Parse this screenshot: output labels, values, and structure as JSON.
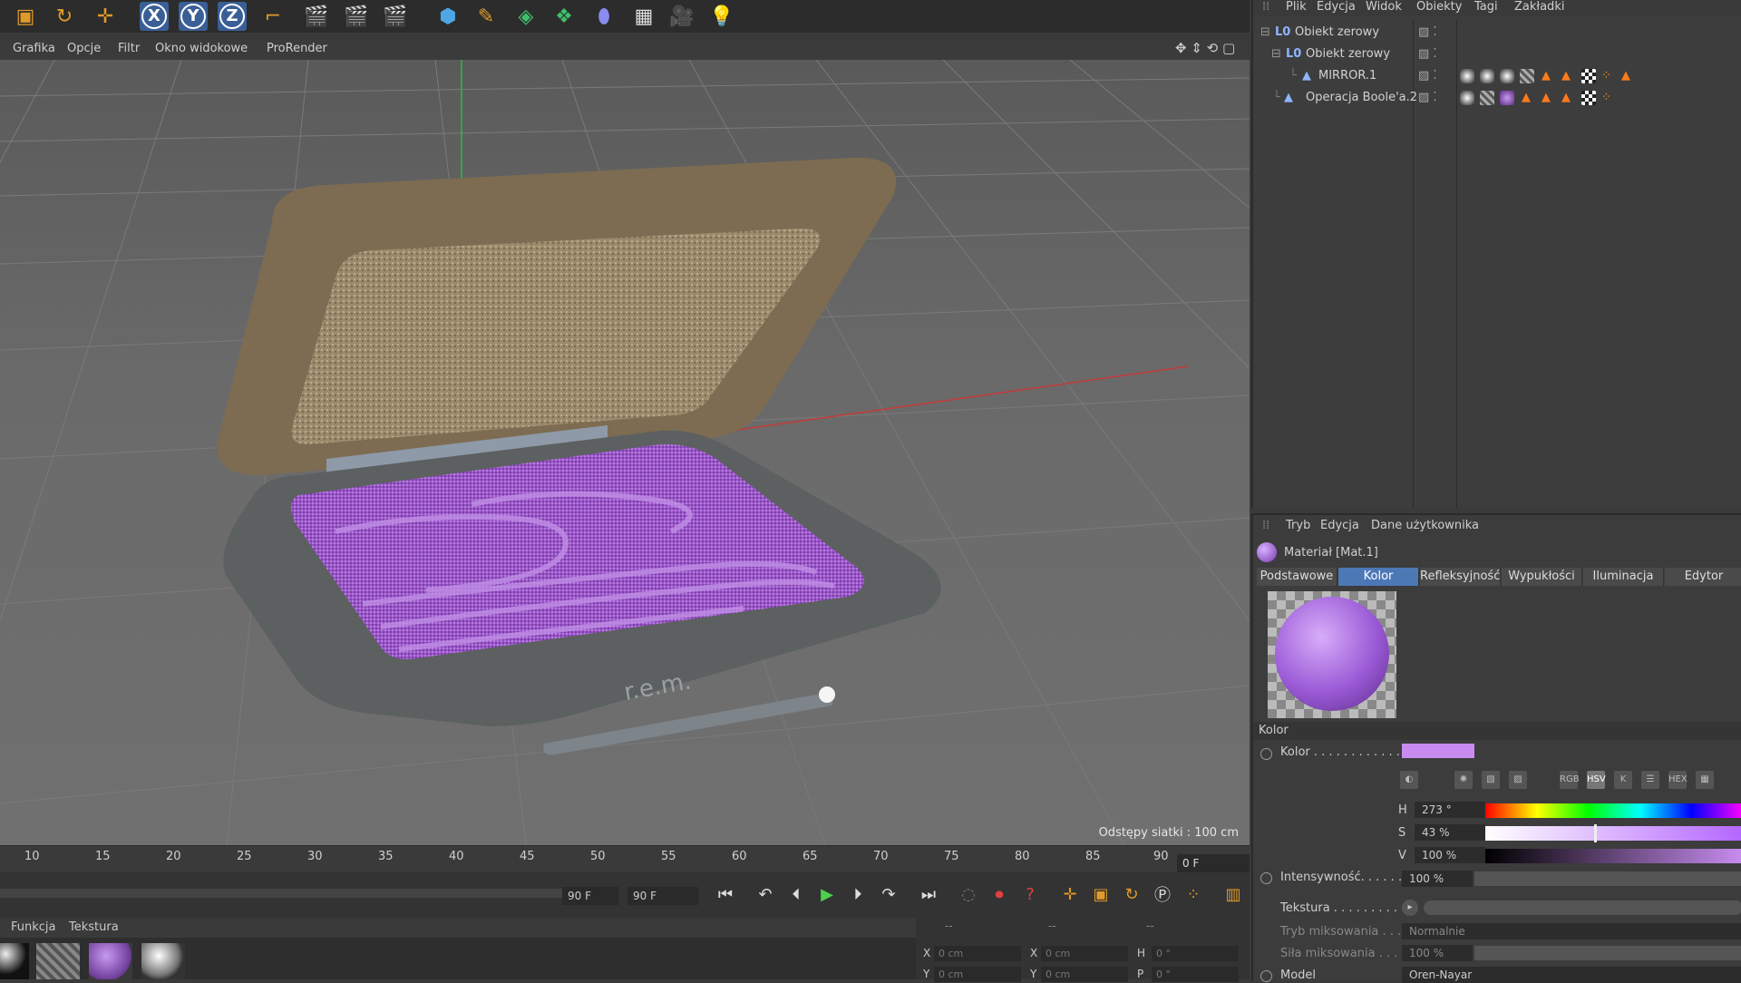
{
  "toolbar": {
    "axis_x": "X",
    "axis_y": "Y",
    "axis_z": "Z"
  },
  "viewport": {
    "menu": [
      "Grafika",
      "Opcje",
      "Filtr",
      "Okno widokowe",
      "ProRender"
    ],
    "grid_spacing": "Odstępy siatki : 100 cm",
    "brand_text": "r.e.m."
  },
  "timeline": {
    "ticks": [
      "10",
      "15",
      "20",
      "25",
      "30",
      "35",
      "40",
      "45",
      "50",
      "55",
      "60",
      "65",
      "70",
      "75",
      "80",
      "85",
      "90"
    ],
    "current_frame": "0 F",
    "end_frame_left": "90 F",
    "end_frame_right": "90 F"
  },
  "material_manager": {
    "menu": [
      "Funkcja",
      "Tekstura"
    ]
  },
  "coords": {
    "header": [
      "--",
      "--",
      "--"
    ],
    "row1": {
      "l1": "X",
      "v1": "0 cm",
      "l2": "X",
      "v2": "0 cm",
      "l3": "H",
      "v3": "0 °"
    },
    "row2": {
      "l1": "Y",
      "v1": "0 cm",
      "l2": "Y",
      "v2": "0 cm",
      "l3": "P",
      "v3": "0 °"
    }
  },
  "object_manager": {
    "menu": [
      "Plik",
      "Edycja",
      "Widok",
      "Obiekty",
      "Tagi",
      "Zakładki"
    ],
    "objects": [
      {
        "name": "Obiekt zerowy"
      },
      {
        "name": "Obiekt zerowy"
      },
      {
        "name": "MIRROR.1"
      },
      {
        "name": "Operacja Boole'a.2"
      }
    ]
  },
  "attributes": {
    "menu": [
      "Tryb",
      "Edycja",
      "Dane użytkownika"
    ],
    "material_name": "Materiał [Mat.1]",
    "tabs": [
      "Podstawowe",
      "Kolor",
      "Refleksyjność",
      "Wypukłości",
      "Iluminacja",
      "Edytor"
    ],
    "section": "Kolor",
    "color_label": "Kolor . . . . . . . . . . . .",
    "color_swatch": "#c88cf0",
    "mode_buttons": [
      "RGB",
      "HSV",
      "K",
      "HEX"
    ],
    "h_label": "H",
    "h_value": "273 °",
    "s_label": "S",
    "s_value": "43 %",
    "v_label": "V",
    "v_value": "100 %",
    "intensity_label": "Intensywność. . . . . .",
    "intensity_value": "100 %",
    "texture_label": "Tekstura . . . . . . . . . .",
    "blend_mode_label": "Tryb miksowania . . .",
    "blend_mode_value": "Normalnie",
    "blend_strength_label": "Siła miksowania . . .",
    "blend_strength_value": "100 %",
    "model_label": "Model",
    "model_value": "Oren-Nayar"
  }
}
